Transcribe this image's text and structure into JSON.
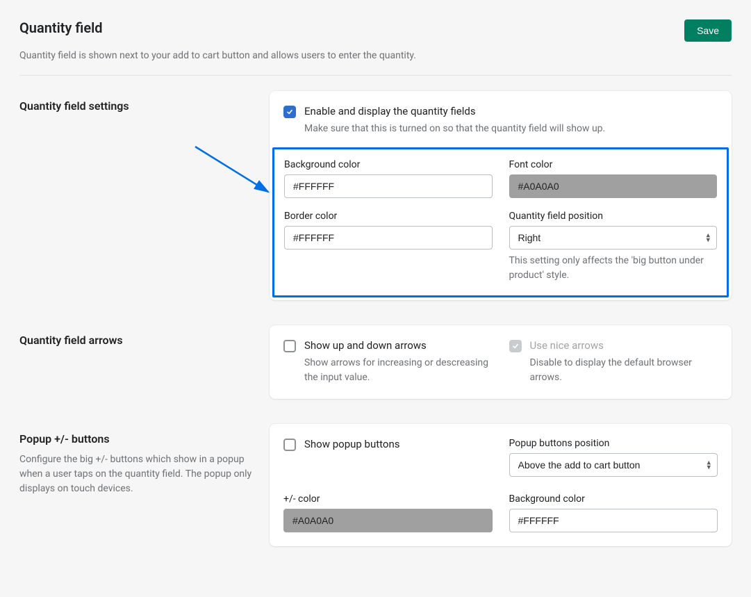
{
  "header": {
    "title": "Quantity field",
    "save": "Save"
  },
  "subtitle": "Quantity field is shown next to your add to cart button and allows users to enter the quantity.",
  "sections": {
    "settings": {
      "title": "Quantity field settings",
      "enable": {
        "label": "Enable and display the quantity fields",
        "help": "Make sure that this is turned on so that the quantity field will show up."
      },
      "bg": {
        "label": "Background color",
        "value": "#FFFFFF"
      },
      "font": {
        "label": "Font color",
        "value": "#A0A0A0"
      },
      "border": {
        "label": "Border color",
        "value": "#FFFFFF"
      },
      "position": {
        "label": "Quantity field position",
        "value": "Right",
        "help": "This setting only affects the 'big button under product' style."
      }
    },
    "arrows": {
      "title": "Quantity field arrows",
      "show": {
        "label": "Show up and down arrows",
        "help": "Show arrows for increasing or descreasing the input value."
      },
      "nice": {
        "label": "Use nice arrows",
        "help": "Disable to display the default browser arrows."
      }
    },
    "popup": {
      "title": "Popup +/- buttons",
      "desc": "Configure the big +/- buttons which show in a popup when a user taps on the quantity field. The popup only displays on touch devices.",
      "show": {
        "label": "Show popup buttons"
      },
      "position": {
        "label": "Popup buttons position",
        "value": "Above the add to cart button"
      },
      "pm_color": {
        "label": "+/- color",
        "value": "#A0A0A0"
      },
      "bg": {
        "label": "Background color",
        "value": "#FFFFFF"
      }
    }
  }
}
